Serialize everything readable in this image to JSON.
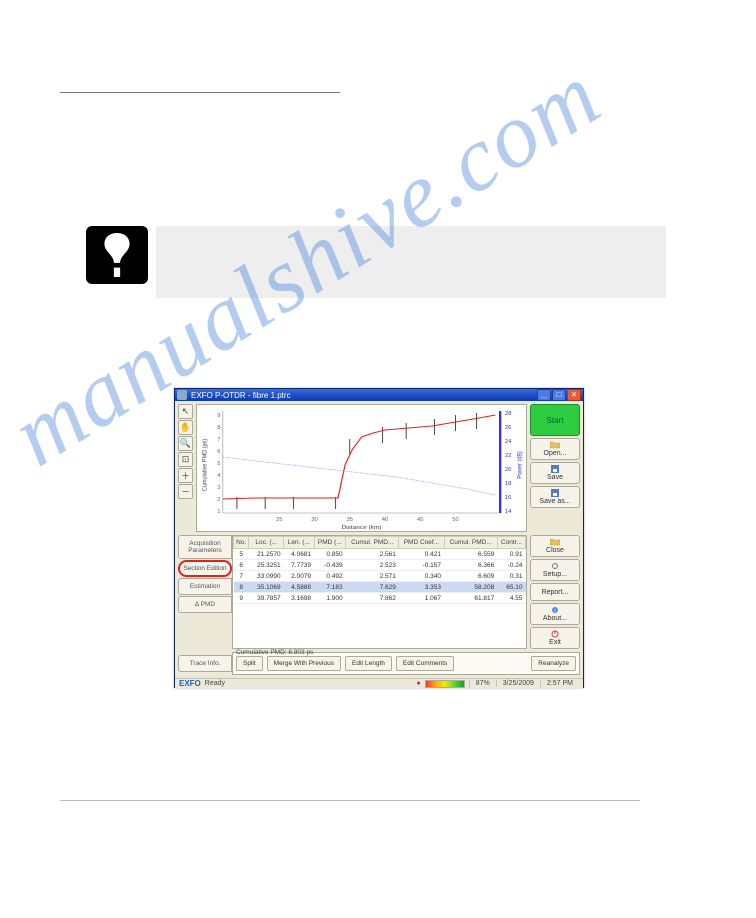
{
  "watermark": "manualshive.com",
  "window": {
    "title": "EXFO P-OTDR - fibre 1.ptrc"
  },
  "sidebar": {
    "start": "Start",
    "open": "Open...",
    "save": "Save",
    "saveas": "Save as...",
    "close": "Close",
    "setup": "Setup...",
    "report": "Report...",
    "about": "About...",
    "exit": "Exit"
  },
  "tabs": {
    "acq": "Acquisition Parameters",
    "section": "Section Edition",
    "estimation": "Estimation",
    "delta": "Δ PMD",
    "trace": "Trace Info."
  },
  "table": {
    "headers": [
      "No.",
      "Loc. (...",
      "Len. (...",
      "PMD (...",
      "Cumul. PMD...",
      "PMD Coef...",
      "Cumul. PMD...",
      "Contr..."
    ],
    "rows": [
      [
        "5",
        "21.2570",
        "4.0681",
        "0.850",
        "2.561",
        "0.421",
        "6.559",
        "0.91"
      ],
      [
        "6",
        "25.3251",
        "7.7739",
        "-0.439",
        "2.523",
        "-0.157",
        "6.366",
        "-0.24"
      ],
      [
        "7",
        "33.0990",
        "2.0079",
        "0.492",
        "2.571",
        "0.340",
        "6.609",
        "0.31"
      ],
      [
        "8",
        "35.1069",
        "4.5888",
        "7.183",
        "7.629",
        "3.353",
        "58.208",
        "65.10"
      ],
      [
        "9",
        "39.7857",
        "3.1698",
        "1.900",
        "7.862",
        "1.067",
        "61.817",
        "4.55"
      ]
    ]
  },
  "actions": {
    "cumlabel": "Cumulative PMD: 8.903 ps",
    "split": "Split",
    "merge": "Merge With Previous",
    "editlen": "Edit Length",
    "editcom": "Edit Comments",
    "reanalyze": "Reanalyze"
  },
  "status": {
    "logo": "EXFO",
    "ready": "Ready",
    "pct": "87%",
    "date": "3/25/2009",
    "time": "2:57 PM"
  },
  "chart_data": {
    "type": "line",
    "xlabel": "Distance (km)",
    "ylabel_left": "Cumulative PMD (ps)",
    "ylabel_right": "Power (dB)",
    "xlim": [
      15,
      55
    ],
    "ylim_left": [
      0,
      9
    ],
    "ylim_right": [
      14,
      28
    ],
    "xticks": [
      25,
      30,
      35,
      40,
      45,
      50
    ],
    "yticks_left": [
      1,
      2,
      3,
      4,
      5,
      6,
      7,
      8,
      9
    ],
    "yticks_right": [
      14,
      16,
      18,
      20,
      22,
      24,
      26,
      28
    ],
    "series": [
      {
        "name": "Cumulative PMD",
        "color": "#d22",
        "x": [
          15,
          21,
          25,
          30,
          33,
          35,
          36,
          37,
          38,
          40,
          43,
          47,
          50,
          53
        ],
        "y": [
          2.3,
          2.5,
          2.5,
          2.5,
          2.6,
          2.6,
          5.0,
          6.5,
          7.2,
          7.6,
          7.8,
          8.0,
          8.5,
          8.9
        ]
      },
      {
        "name": "Power",
        "color": "#b08fd6",
        "x": [
          15,
          20,
          25,
          30,
          35,
          40,
          45,
          50,
          55
        ],
        "y": [
          22,
          21,
          20,
          19,
          18.5,
          18,
          17,
          16,
          15
        ]
      }
    ],
    "markers_x": [
      17,
      21.3,
      25.3,
      33.1,
      35.1,
      39.8,
      43,
      47,
      50,
      53
    ]
  }
}
